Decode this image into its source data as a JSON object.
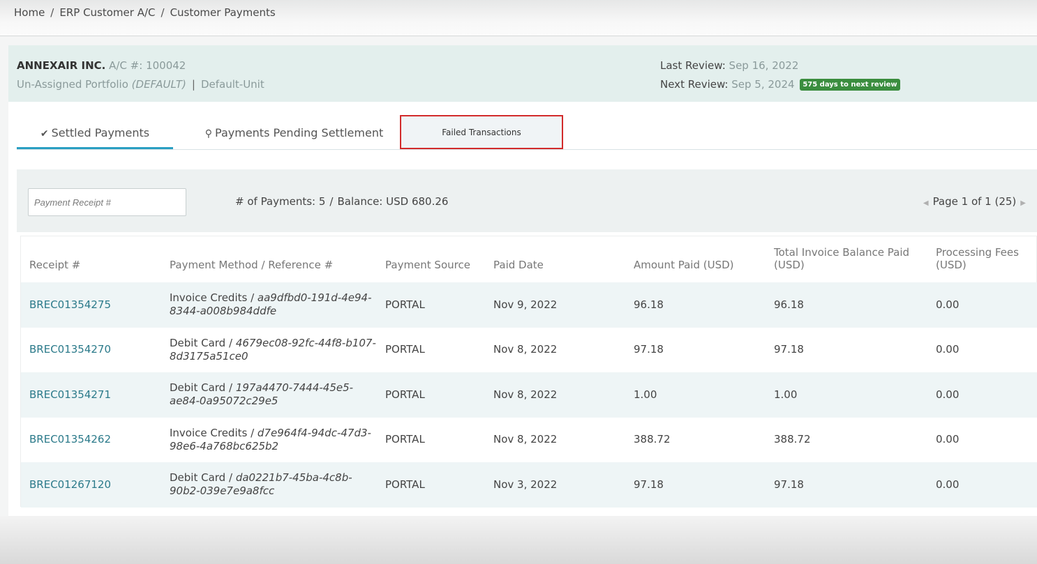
{
  "breadcrumb": [
    "Home",
    "ERP Customer A/C",
    "Customer Payments"
  ],
  "account": {
    "name": "ANNEXAIR INC.",
    "acct_label": "A/C #:",
    "acct_number": "100042",
    "portfolio": "Un-Assigned Portfolio",
    "portfolio_tag": "(DEFAULT)",
    "unit": "Default-Unit",
    "last_review_label": "Last Review:",
    "last_review": "Sep 16, 2022",
    "next_review_label": "Next Review:",
    "next_review": "Sep 5, 2024",
    "next_review_badge": "575 days to next review"
  },
  "tabs": [
    {
      "label": "Settled Payments",
      "icon": "check-icon",
      "active": true
    },
    {
      "label": "Payments Pending Settlement",
      "icon": "user-icon",
      "active": false
    },
    {
      "label": "Failed Transactions",
      "icon": "",
      "active": false
    }
  ],
  "filter": {
    "placeholder": "Payment Receipt #",
    "payments_label": "# of Payments: 5",
    "balance_label": "Balance: USD 680.26",
    "pager": "Page 1 of 1 (25)"
  },
  "table": {
    "columns": [
      "Receipt #",
      "Payment Method / Reference #",
      "Payment Source",
      "Paid Date",
      "Amount Paid (USD)",
      "Total Invoice Balance Paid (USD)",
      "Processing Fees (USD)"
    ],
    "rows": [
      {
        "receipt": "BREC01354275",
        "method": "Invoice Credits",
        "ref": "aa9dfbd0-191d-4e94-8344-a008b984ddfe",
        "source": "PORTAL",
        "date": "Nov 9, 2022",
        "amount": "96.18",
        "invoice": "96.18",
        "fees": "0.00"
      },
      {
        "receipt": "BREC01354270",
        "method": "Debit Card",
        "ref": "4679ec08-92fc-44f8-b107-8d3175a51ce0",
        "source": "PORTAL",
        "date": "Nov 8, 2022",
        "amount": "97.18",
        "invoice": "97.18",
        "fees": "0.00"
      },
      {
        "receipt": "BREC01354271",
        "method": "Debit Card",
        "ref": "197a4470-7444-45e5-ae84-0a95072c29e5",
        "source": "PORTAL",
        "date": "Nov 8, 2022",
        "amount": "1.00",
        "invoice": "1.00",
        "fees": "0.00"
      },
      {
        "receipt": "BREC01354262",
        "method": "Invoice Credits",
        "ref": "d7e964f4-94dc-47d3-98e6-4a768bc625b2",
        "source": "PORTAL",
        "date": "Nov 8, 2022",
        "amount": "388.72",
        "invoice": "388.72",
        "fees": "0.00"
      },
      {
        "receipt": "BREC01267120",
        "method": "Debit Card",
        "ref": "da0221b7-45ba-4c8b-90b2-039e7e9a8fcc",
        "source": "PORTAL",
        "date": "Nov 3, 2022",
        "amount": "97.18",
        "invoice": "97.18",
        "fees": "0.00"
      }
    ]
  },
  "colors": {
    "accent": "#2a9fc2",
    "badge": "#3a8d3e",
    "highlight_border": "#d22b2b",
    "link": "#2b7a8a"
  }
}
